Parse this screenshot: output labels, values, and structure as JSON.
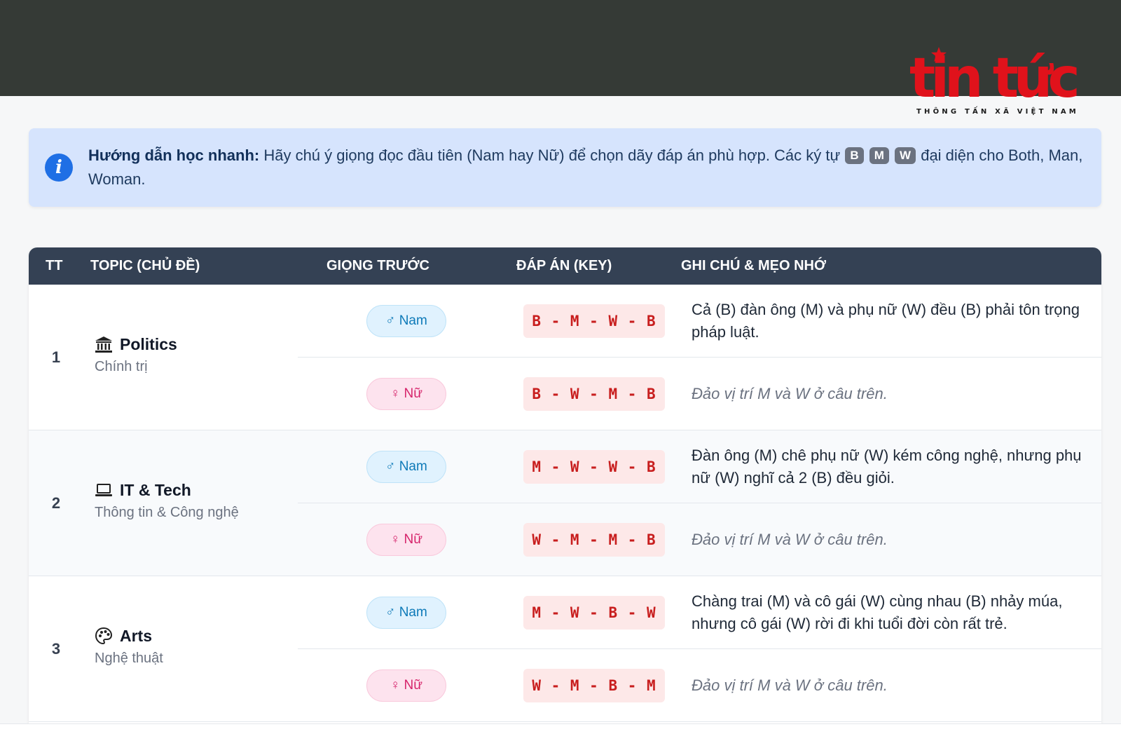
{
  "logo": {
    "main": "tin tức",
    "sub": "THÔNG TẤN XÃ VIỆT NAM"
  },
  "info": {
    "icon": "info-icon",
    "bold": "Hướng dẫn học nhanh:",
    "text1": " Hãy chú ý giọng đọc đầu tiên (Nam hay Nữ) để chọn dãy đáp án phù hợp. Các ký tự ",
    "keys": [
      "B",
      "M",
      "W"
    ],
    "text2": " đại diện cho Both, Man, Woman."
  },
  "table": {
    "headers": [
      "TT",
      "TOPIC (CHỦ ĐỀ)",
      "GIỌNG TRƯỚC",
      "ĐÁP ÁN (KEY)",
      "GHI CHÚ & MẸO NHỚ"
    ],
    "rows": [
      {
        "num": "1",
        "title": "Politics",
        "subtitle": "Chính trị",
        "icon": "bank-icon",
        "male": {
          "voice": "♂ Nam",
          "key": "B - M - W - B",
          "note": "Cả (B) đàn ông (M) và phụ nữ (W) đều (B) phải tôn trọng pháp luật."
        },
        "female": {
          "voice": "♀ Nữ",
          "key": "B - W - M - B",
          "note": "Đảo vị trí M và W ở câu trên."
        }
      },
      {
        "num": "2",
        "title": "IT & Tech",
        "subtitle": "Thông tin & Công nghệ",
        "icon": "laptop-icon",
        "male": {
          "voice": "♂ Nam",
          "key": "M - W - W - B",
          "note": "Đàn ông (M) chê phụ nữ (W) kém công nghệ, nhưng phụ nữ (W) nghĩ cả 2 (B) đều giỏi."
        },
        "female": {
          "voice": "♀ Nữ",
          "key": "W - M - M - B",
          "note": "Đảo vị trí M và W ở câu trên."
        }
      },
      {
        "num": "3",
        "title": "Arts",
        "subtitle": "Nghệ thuật",
        "icon": "palette-icon",
        "male": {
          "voice": "♂ Nam",
          "key": "M - W - B - W",
          "note": "Chàng trai (M) và cô gái (W) cùng nhau (B) nhảy múa, nhưng cô gái (W) rời đi khi tuổi đời còn rất trẻ."
        },
        "female": {
          "voice": "♀ Nữ",
          "key": "W - M - B - M",
          "note": "Đảo vị trí M và W ở câu trên."
        }
      }
    ]
  },
  "colors": {
    "header_bg": "#344154",
    "topbar": "#353a36",
    "info_bg": "#d6e4fd",
    "key_text": "#c81e1e",
    "male": "#0e7ab8",
    "female": "#d6246b",
    "logo_red": "#e0121b"
  }
}
